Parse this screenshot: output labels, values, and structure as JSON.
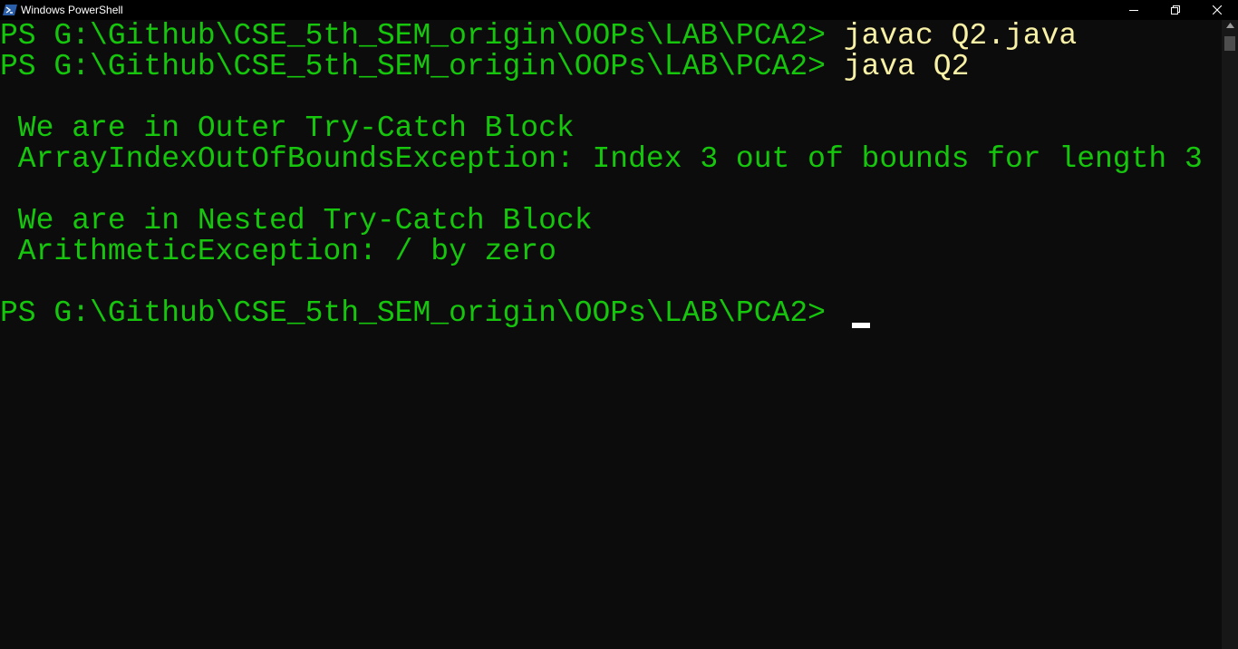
{
  "window": {
    "title": "Windows PowerShell",
    "icon": "powershell-icon",
    "controls": [
      "minimize-icon",
      "restore-icon",
      "close-icon"
    ]
  },
  "terminal": {
    "prompt": "PS G:\\Github\\CSE_5th_SEM_origin\\OOPs\\LAB\\PCA2> ",
    "commands": [
      "javac Q2.java",
      "java Q2"
    ],
    "output": [
      " We are in Outer Try-Catch Block",
      " ArrayIndexOutOfBoundsException: Index 3 out of bounds for length 3",
      " We are in Nested Try-Catch Block",
      " ArithmeticException: / by zero"
    ],
    "colors": {
      "background": "#0c0c0c",
      "prompt_text": "#16c60c",
      "command_text": "#f9f1a5",
      "cursor": "#ffffff"
    }
  }
}
